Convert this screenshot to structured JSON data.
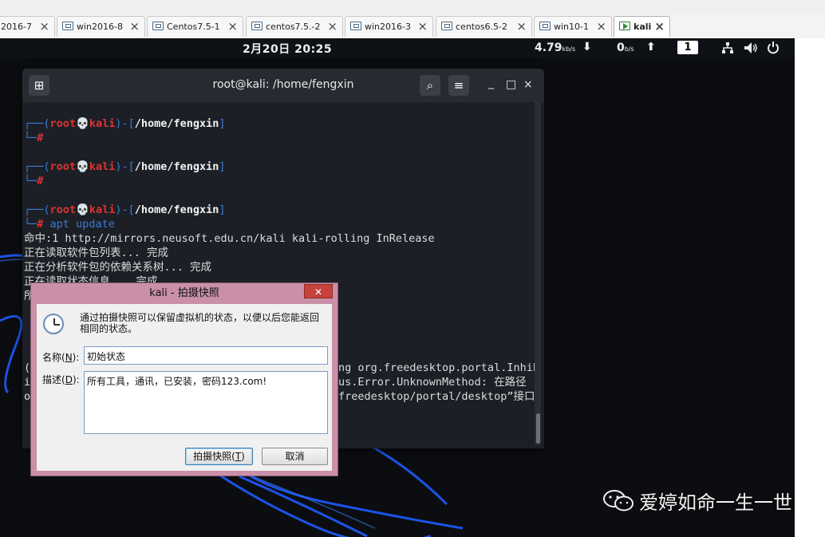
{
  "vm_tabs": [
    {
      "label": "2016-7",
      "active": false
    },
    {
      "label": "win2016-8",
      "active": false
    },
    {
      "label": "Centos7.5-1",
      "active": false
    },
    {
      "label": "centos7.5.-2",
      "active": false
    },
    {
      "label": "win2016-3",
      "active": false
    },
    {
      "label": "centos6.5-2",
      "active": false
    },
    {
      "label": "win10-1",
      "active": false
    },
    {
      "label": "kali",
      "active": true
    }
  ],
  "tab_close_glyph": "×",
  "panel": {
    "datetime": "2月20日 20:25",
    "download_value": "4.79",
    "download_unit": "kb/s",
    "upload_value": "0",
    "upload_unit": "b/s",
    "workspace": "1",
    "down_arrow": "⬇",
    "up_arrow": "⬆"
  },
  "terminal": {
    "title": "root@kali: /home/fengxin",
    "new_tab_glyph": "⊞",
    "search_glyph": "⌕",
    "menu_glyph": "≡",
    "minimize": "_",
    "maximize": "□",
    "close": "×",
    "prompt": {
      "open": "┌──(",
      "user": "root",
      "skull": "💀",
      "host": "kali",
      "mid": ")-[",
      "path": "/home/fengxin",
      "close": "]",
      "second": "└─",
      "hash": "#"
    },
    "command": "apt update",
    "output": [
      "命中:1 http://mirrors.neusoft.edu.cn/kali kali-rolling InRelease",
      "正在读取软件包列表... 完成",
      "正在分析软件包的依赖关系树... 完成",
      "正在读取状态信息... 完成",
      "所"
    ],
    "hidden_output": [
      "ng org.freedesktop.portal.Inhib",
      "us.Error.UnknownMethod: 在路径",
      "freedesktop/portal/desktop”接口"
    ],
    "partial_left": [
      "(",
      "i",
      "o"
    ]
  },
  "dialog": {
    "title": "kali - 拍摄快照",
    "close_glyph": "✕",
    "description": "通过拍摄快照可以保留虚拟机的状态，以便以后您能返回相同的状态。",
    "name_label": "名称(",
    "name_key": "N",
    "name_label_end": "):",
    "name_value": "初始状态",
    "desc_label": "描述(",
    "desc_key": "D",
    "desc_label_end": "):",
    "desc_value": "所有工具，通讯，已安装，密码123.com!",
    "ok_label": "拍摄快照(",
    "ok_key": "T",
    "ok_label_end": ")",
    "cancel_label": "取消"
  },
  "watermark": {
    "text": "爱婷如命一生一世"
  },
  "colors": {
    "kali_blue": "#3a7bd5",
    "kali_red": "#e0322f",
    "dialog_frame": "#c990a8",
    "close_red": "#c7423b",
    "neon_blue": "#1e5bff"
  }
}
